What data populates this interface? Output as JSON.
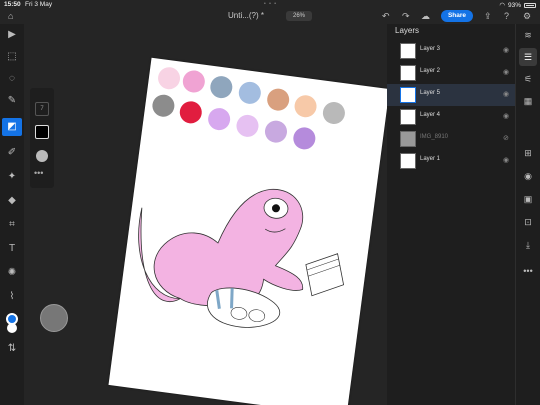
{
  "status": {
    "time": "15:50",
    "date": "Fri 3 May",
    "battery": "93%"
  },
  "topbar": {
    "title": "Unti...(?) *",
    "zoom": "26%",
    "share_label": "Share"
  },
  "left_tools": [
    "select-icon",
    "transform-icon",
    "lasso-icon",
    "brush-icon",
    "eraser-icon",
    "smudge-icon",
    "clone-icon",
    "fill-icon",
    "crop-icon",
    "text-icon",
    "adjust-icon",
    "eyedropper-icon",
    "color-icon",
    "swap-icon"
  ],
  "brush_panel": {
    "size": "7"
  },
  "palette": [
    "#f8d3e4",
    "#f0a3d3",
    "#8fa6bd",
    "#a3bde0",
    "#d9a07f",
    "#f7c9a8",
    "#b9b9b9",
    "#8c8c8c",
    "#e11d3f",
    "#d7a8ef",
    "#e6c1f2",
    "#c8a9e0",
    "#b58bdc"
  ],
  "layers": {
    "title": "Layers",
    "items": [
      {
        "name": "Layer 3",
        "selected": false,
        "hidden": false
      },
      {
        "name": "Layer 2",
        "selected": false,
        "hidden": false
      },
      {
        "name": "Layer 5",
        "selected": true,
        "hidden": false
      },
      {
        "name": "Layer 4",
        "selected": false,
        "hidden": false
      },
      {
        "name": "IMG_8910",
        "selected": false,
        "hidden": true
      },
      {
        "name": "Layer 1",
        "selected": false,
        "hidden": false
      }
    ]
  },
  "right_tools": [
    "layers-icon",
    "layer-props-icon",
    "adjustments-icon",
    "add-layer-icon",
    "visibility-icon",
    "mask-icon",
    "clip-icon",
    "merge-icon",
    "more-icon"
  ]
}
